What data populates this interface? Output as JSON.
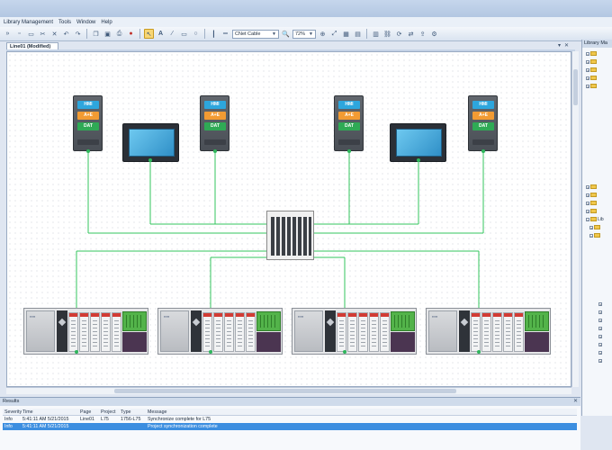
{
  "menu": [
    "Library Management",
    "Tools",
    "Window",
    "Help"
  ],
  "toolbar": {
    "cable_type": "CNet Cable",
    "zoom": "72%"
  },
  "document": {
    "tab_title": "Line01 (Modified)"
  },
  "canvas": {
    "hmi_buttons": [
      "HMI",
      "A+E",
      "DAT"
    ]
  },
  "library_panel": {
    "title": "Library Ma",
    "tree_label": "Lib"
  },
  "results": {
    "title": "Results",
    "columns": [
      "Severity",
      "Time",
      "Page",
      "Project",
      "Type",
      "Message"
    ],
    "rows": [
      {
        "severity": "Info",
        "time": "5:41:11 AM 5/21/2015",
        "page": "Line01",
        "project": "L75",
        "type": "1756-L75",
        "message": "Synchronize complete for L75"
      },
      {
        "severity": "Info",
        "time": "5:41:11 AM 5/21/2015",
        "page": "",
        "project": "",
        "type": "",
        "message": "Project synchronization complete"
      }
    ]
  },
  "colors": {
    "connection": "#33c45e",
    "selection": "#3c8ee0"
  }
}
